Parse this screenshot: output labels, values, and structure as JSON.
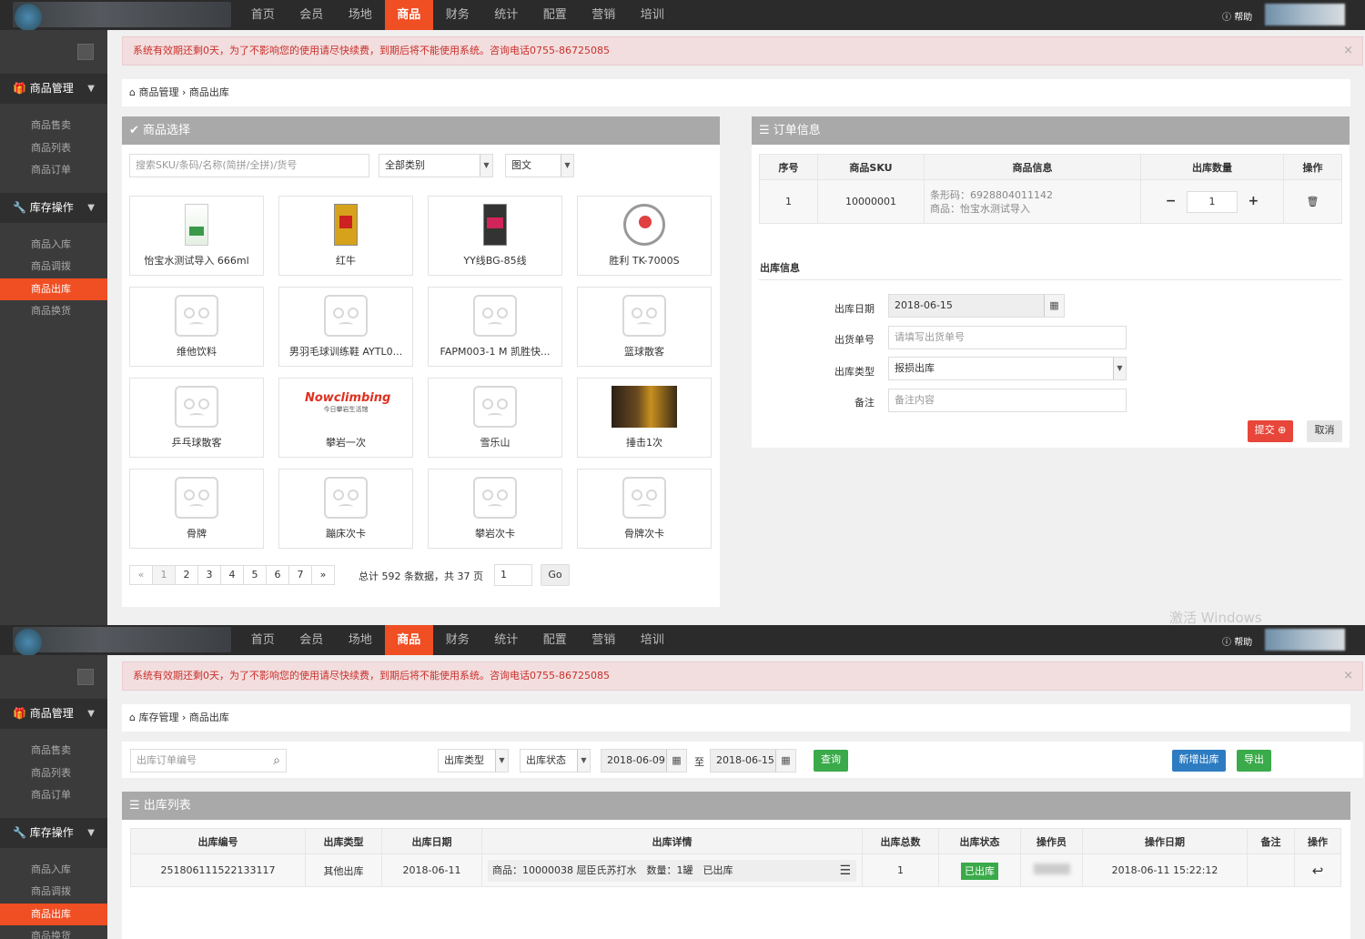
{
  "nav": [
    "首页",
    "会员",
    "场地",
    "商品",
    "财务",
    "统计",
    "配置",
    "营销",
    "培训"
  ],
  "nav_active": "商品",
  "help": "帮助",
  "sidebar": {
    "group1": "商品管理",
    "group1_items": [
      "商品售卖",
      "商品列表",
      "商品订单"
    ],
    "group2": "库存操作",
    "group2_items": [
      "商品入库",
      "商品调拨",
      "商品出库",
      "商品换货"
    ],
    "active": "商品出库"
  },
  "alert": "系统有效期还剩0天，为了不影响您的使用请尽快续费，到期后将不能使用系统。咨询电话0755-86725085",
  "screen1": {
    "breadcrumb": "商品管理 › 商品出库",
    "select_title": "商品选择",
    "search_placeholder": "搜索SKU/条码/名称(简拼/全拼)/货号",
    "category": "全部类别",
    "view_mode": "图文",
    "products": [
      "怡宝水测试导入 666ml",
      "红牛",
      "YY线BG-85线",
      "胜利 TK-7000S",
      "维他饮料",
      "男羽毛球训练鞋 AYTL0...",
      "FAPM003-1 M 凯胜快...",
      "篮球散客",
      "乒乓球散客",
      "攀岩一次",
      "雪乐山",
      "捶击1次",
      "骨牌",
      "蹦床次卡",
      "攀岩次卡",
      "骨牌次卡"
    ],
    "nowclimbing": "Nowclimbing",
    "nowclimbing_sub": "今日攀岩生活馆",
    "pages": [
      "«",
      "1",
      "2",
      "3",
      "4",
      "5",
      "6",
      "7",
      "»"
    ],
    "total_text": "总计 592 条数据，共 37 页",
    "page_input": "1",
    "go": "Go",
    "order_title": "订单信息",
    "order_headers": [
      "序号",
      "商品SKU",
      "商品信息",
      "出库数量",
      "操作"
    ],
    "order_row": {
      "no": "1",
      "sku": "10000001",
      "barcode": "条形码：6928804011142",
      "product": "商品：怡宝水测试导入",
      "qty": "1"
    },
    "out_info_title": "出库信息",
    "labels": [
      "出库日期",
      "出货单号",
      "出库类型",
      "备注"
    ],
    "out_date": "2018-06-15",
    "bill_placeholder": "请填写出货单号",
    "out_type": "报损出库",
    "remark_placeholder": "备注内容",
    "submit": "提交",
    "cancel": "取消"
  },
  "screen2": {
    "breadcrumb": "库存管理 › 商品出库",
    "order_placeholder": "出库订单编号",
    "type_select": "出库类型",
    "status_select": "出库状态",
    "date_from": "2018-06-09",
    "to": "至",
    "date_to": "2018-06-15",
    "query": "查询",
    "new_out": "新增出库",
    "export": "导出",
    "list_title": "出库列表",
    "headers": [
      "出库编号",
      "出库类型",
      "出库日期",
      "出库详情",
      "出库总数",
      "出库状态",
      "操作员",
      "操作日期",
      "备注",
      "操作"
    ],
    "row": {
      "id": "251806111522133117",
      "type": "其他出库",
      "date": "2018-06-11",
      "detail": "商品：10000038 屈臣氏苏打水　数量：1罐　已出库",
      "total": "1",
      "status": "已出库",
      "op_date": "2018-06-11 15:22:12"
    }
  },
  "watermark": "激活 Windows"
}
